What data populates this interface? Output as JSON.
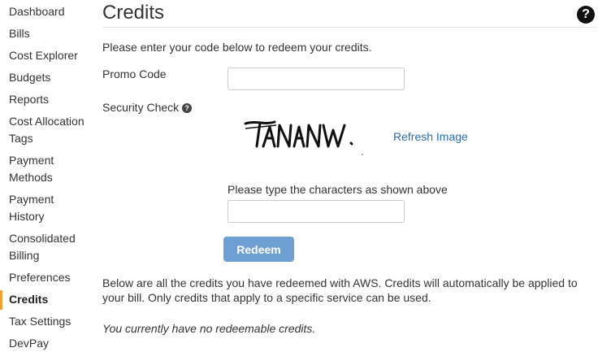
{
  "sidebar": {
    "items": [
      {
        "label": "Dashboard"
      },
      {
        "label": "Bills"
      },
      {
        "label": "Cost Explorer"
      },
      {
        "label": "Budgets"
      },
      {
        "label": "Reports"
      },
      {
        "label": "Cost Allocation"
      },
      {
        "label": "Tags"
      },
      {
        "label": "Payment"
      },
      {
        "label": "Methods"
      },
      {
        "label": "Payment"
      },
      {
        "label": "History"
      },
      {
        "label": "Consolidated"
      },
      {
        "label": "Billing"
      },
      {
        "label": "Preferences"
      },
      {
        "label": "Credits"
      },
      {
        "label": "Tax Settings"
      },
      {
        "label": "DevPay"
      }
    ],
    "active": "Credits",
    "accent_color": "#f0a030"
  },
  "header": {
    "title": "Credits",
    "help_icon": "question-circle-icon",
    "help_glyph": "?"
  },
  "form": {
    "intro": "Please enter your code below to redeem your credits.",
    "promo_label": "Promo Code",
    "promo_value": "",
    "security_label": "Security Check",
    "security_help_glyph": "?",
    "captcha_text": "TANANW",
    "refresh_label": "Refresh Image",
    "captcha_prompt": "Please type the characters as shown above",
    "captcha_value": "",
    "redeem_label": "Redeem",
    "button_color": "#6e9fd3",
    "link_color": "#2a6cb7"
  },
  "credits": {
    "info": "Below are all the credits you have redeemed with AWS. Credits will automatically be applied to your bill. Only credits that apply to a specific service can be used.",
    "empty_message": "You currently have no redeemable credits."
  }
}
